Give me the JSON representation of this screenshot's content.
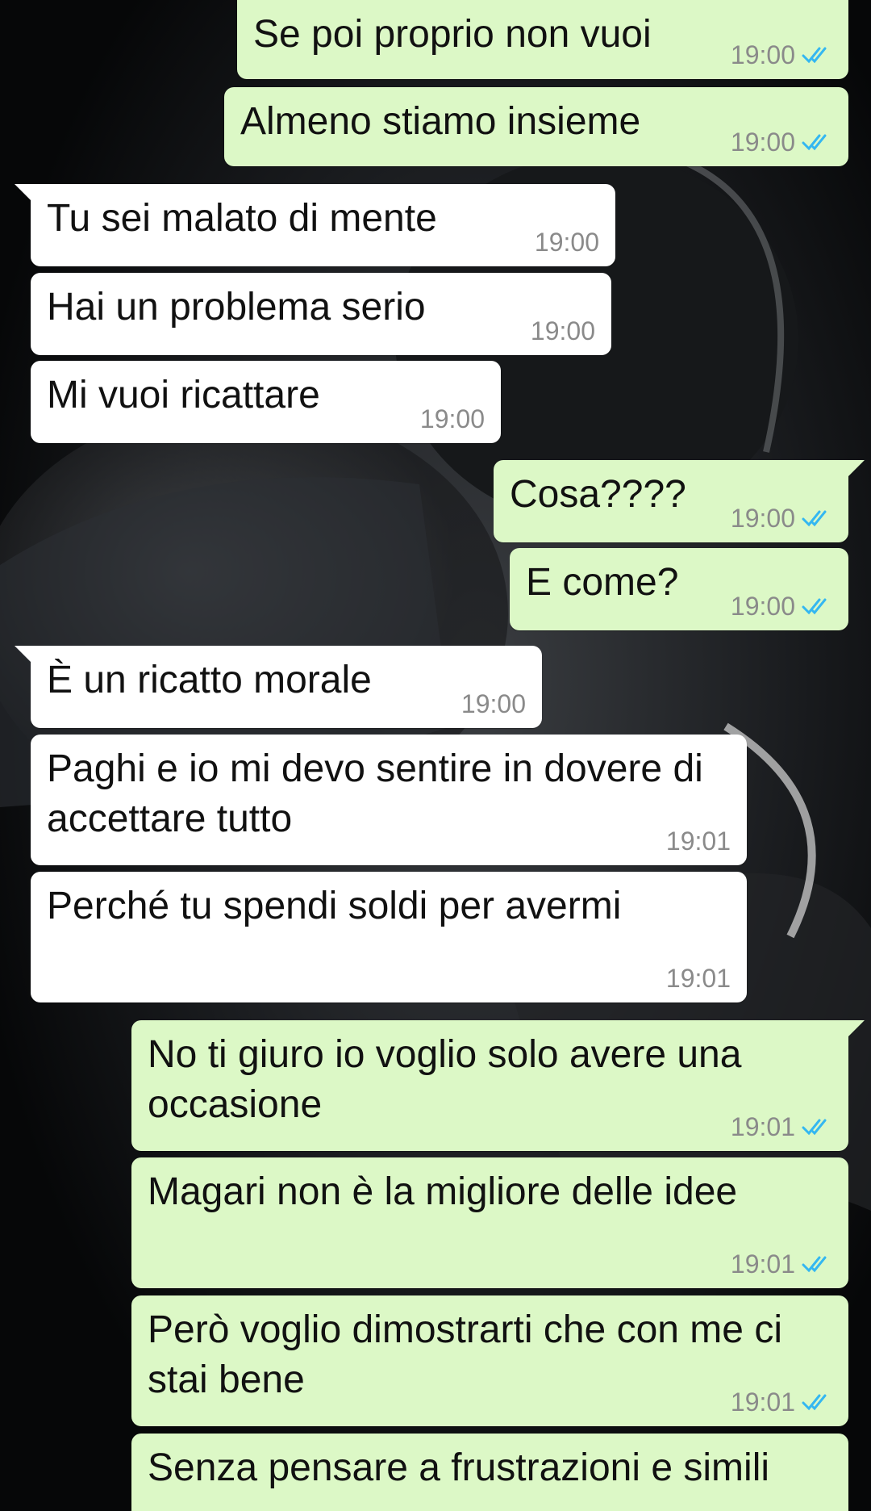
{
  "chat": {
    "colors": {
      "outgoing_bubble": "#dcf8c6",
      "incoming_bubble": "#ffffff",
      "read_ticks": "#34b7f1",
      "timestamp": "#8a8a8a"
    },
    "messages": [
      {
        "direction": "out",
        "text": "Se poi proprio non vuoi",
        "time": "19:00",
        "status_icon": "double-check-read-icon"
      },
      {
        "direction": "out",
        "text": "Almeno stiamo insieme",
        "time": "19:00",
        "status_icon": "double-check-read-icon"
      },
      {
        "direction": "in",
        "text": "Tu sei malato di mente",
        "time": "19:00"
      },
      {
        "direction": "in",
        "text": "Hai un problema serio",
        "time": "19:00"
      },
      {
        "direction": "in",
        "text": "Mi vuoi ricattare",
        "time": "19:00"
      },
      {
        "direction": "out",
        "text": "Cosa????",
        "time": "19:00",
        "status_icon": "double-check-read-icon"
      },
      {
        "direction": "out",
        "text": "E come?",
        "time": "19:00",
        "status_icon": "double-check-read-icon"
      },
      {
        "direction": "in",
        "text": "È un ricatto morale",
        "time": "19:00"
      },
      {
        "direction": "in",
        "text": "Paghi e io mi devo sentire in dovere di accettare tutto",
        "time": "19:01"
      },
      {
        "direction": "in",
        "text": "Perché tu spendi soldi per avermi",
        "time": "19:01"
      },
      {
        "direction": "out",
        "text": "No ti giuro io voglio solo avere una occasione",
        "time": "19:01",
        "status_icon": "double-check-read-icon"
      },
      {
        "direction": "out",
        "text": "Magari non è la migliore delle idee",
        "time": "19:01",
        "status_icon": "double-check-read-icon"
      },
      {
        "direction": "out",
        "text": "Però voglio dimostrarti che con me ci stai bene",
        "time": "19:01",
        "status_icon": "double-check-read-icon"
      },
      {
        "direction": "out",
        "text": "Senza pensare a frustrazioni e simili",
        "time": "",
        "status_icon": ""
      }
    ]
  }
}
